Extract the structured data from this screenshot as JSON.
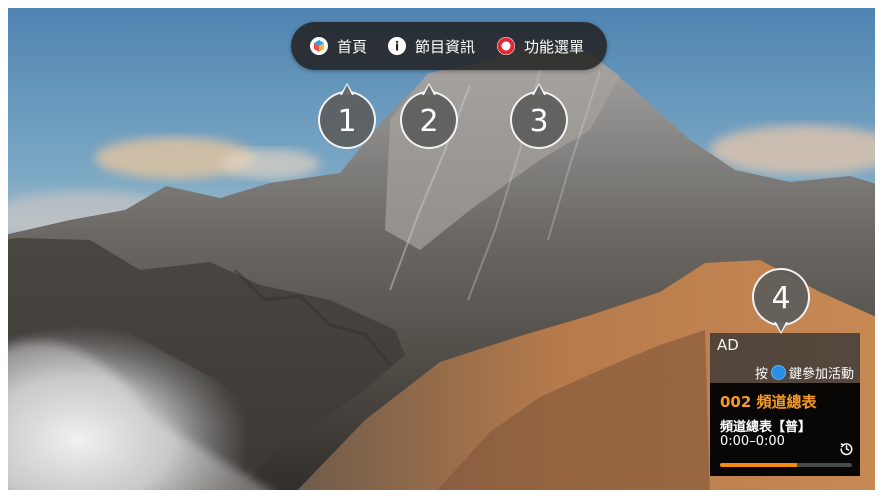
{
  "top_menu": {
    "items": [
      {
        "label": "首頁",
        "icon": "home-cube-icon"
      },
      {
        "label": "節目資訊",
        "icon": "info-icon"
      },
      {
        "label": "功能選單",
        "icon": "red-ring-icon"
      }
    ]
  },
  "callouts": {
    "one": "1",
    "two": "2",
    "three": "3",
    "four": "4"
  },
  "ad_panel": {
    "label": "AD",
    "action_prefix": "按",
    "action_suffix": "鍵參加活動",
    "blue_key_color": "#2b8ee5"
  },
  "channel": {
    "title": "002 頻道總表",
    "program": "頻道總表【普】",
    "time": "0:00–0:00",
    "progress": 0.58,
    "progress_color": "#f28b0f",
    "replay_icon": "replay-icon"
  },
  "colors": {
    "menu_background": "#232323",
    "callout_background": "#5c5c5c",
    "channel_title": "#f79b20"
  }
}
